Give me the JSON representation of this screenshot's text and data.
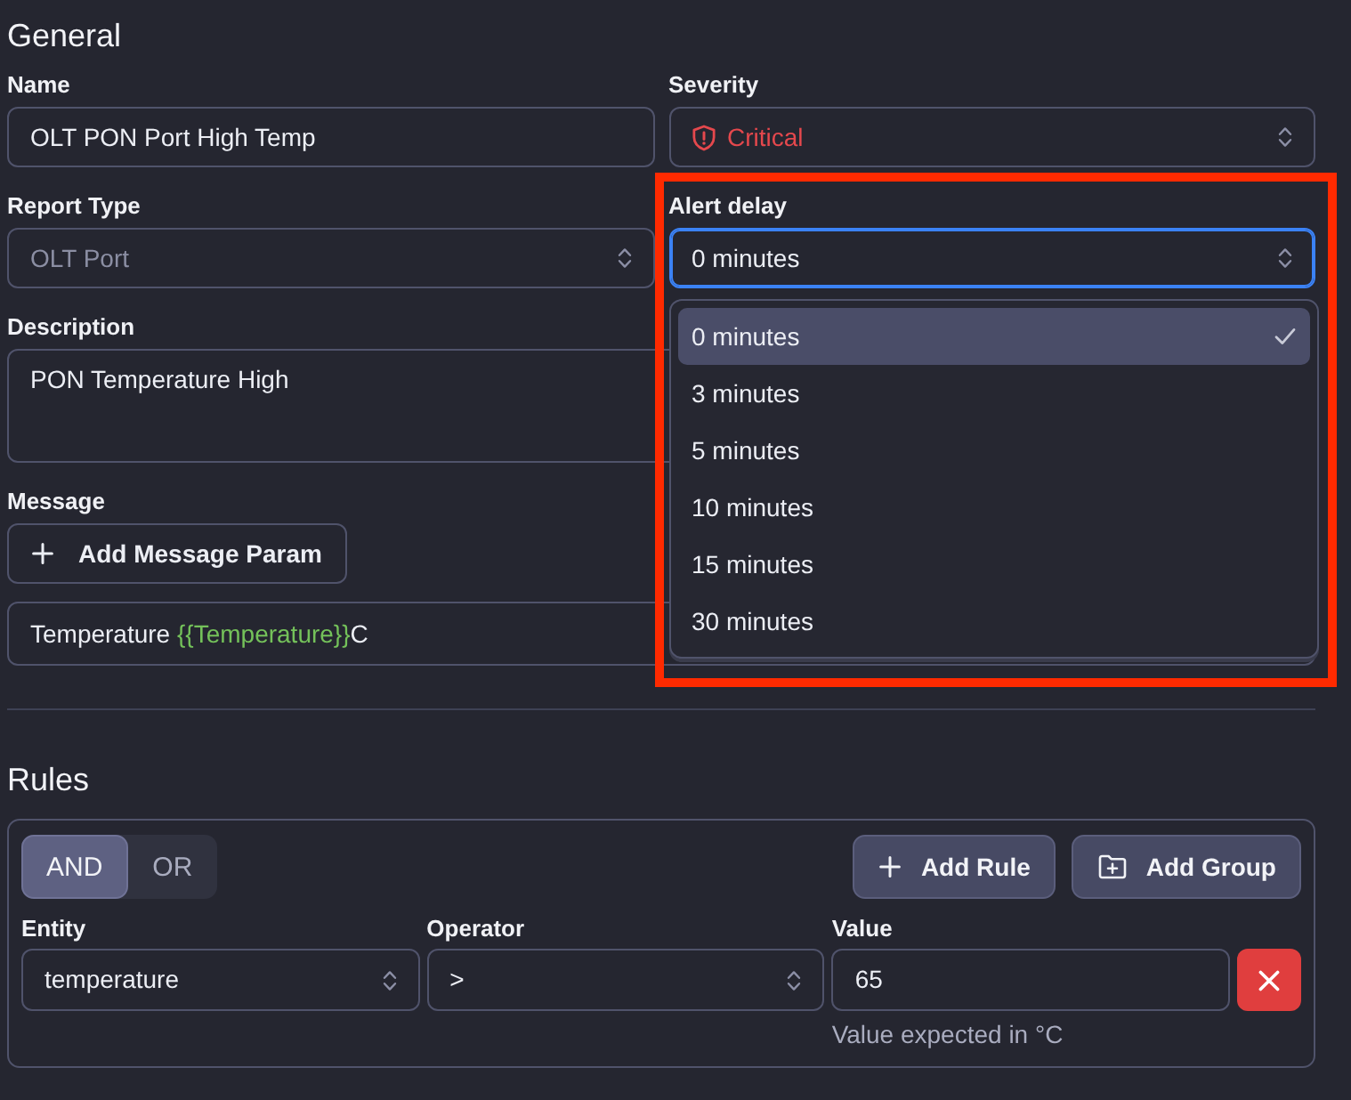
{
  "general": {
    "heading": "General",
    "name": {
      "label": "Name",
      "value": "OLT PON Port High Temp"
    },
    "severity": {
      "label": "Severity",
      "value": "Critical"
    },
    "report_type": {
      "label": "Report Type",
      "value": "OLT Port",
      "disabled": true
    },
    "alert_delay": {
      "label": "Alert delay",
      "value": "0 minutes",
      "focused": true,
      "expanded": true,
      "highlighted": true,
      "options": [
        {
          "label": "0 minutes",
          "selected": true
        },
        {
          "label": "3 minutes",
          "selected": false
        },
        {
          "label": "5 minutes",
          "selected": false
        },
        {
          "label": "10 minutes",
          "selected": false
        },
        {
          "label": "15 minutes",
          "selected": false
        },
        {
          "label": "30 minutes",
          "selected": false
        }
      ]
    },
    "description": {
      "label": "Description",
      "value": "PON Temperature High"
    },
    "message": {
      "label": "Message",
      "add_button": "Add Message Param",
      "value": [
        {
          "kind": "text",
          "text": "Temperature "
        },
        {
          "kind": "param",
          "text": "{{Temperature}}"
        },
        {
          "kind": "text",
          "text": "C"
        }
      ]
    }
  },
  "rules": {
    "heading": "Rules",
    "combinator": [
      {
        "label": "AND",
        "selected": true
      },
      {
        "label": "OR",
        "selected": false
      }
    ],
    "actions": [
      {
        "kind": "add",
        "label": "Add Rule"
      },
      {
        "kind": "group",
        "label": "Add Group"
      }
    ],
    "conditions": [
      {
        "fields": [
          {
            "kind": "select",
            "label": "Entity",
            "value": "temperature"
          },
          {
            "kind": "select",
            "label": "Operator",
            "value": ">"
          },
          {
            "kind": "input",
            "label": "Value",
            "value": "65",
            "help": "Value expected in °C"
          }
        ]
      }
    ]
  }
}
